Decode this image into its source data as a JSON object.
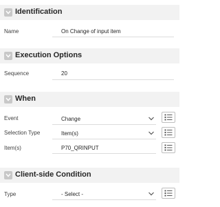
{
  "sections": {
    "identification": {
      "title": "Identification",
      "name_label": "Name",
      "name_value": "On Change of input  item"
    },
    "execution_options": {
      "title": "Execution Options",
      "sequence_label": "Sequence",
      "sequence_value": "20"
    },
    "when": {
      "title": "When",
      "event_label": "Event",
      "event_value": "Change",
      "selection_type_label": "Selection Type",
      "selection_type_value": "Item(s)",
      "items_label": "Item(s)",
      "items_value": "P70_QRINPUT"
    },
    "client_side_condition": {
      "title": "Client-side Condition",
      "type_label": "Type",
      "type_value": "- Select -"
    }
  },
  "icons": {
    "collapse": "chevron-down-icon",
    "dropdown": "chevron-down-icon",
    "list": "list-icon"
  },
  "colors": {
    "header_bg": "#f2f2f2",
    "icon_bg": "#c8c8c8",
    "divider": "#dcdcdc"
  }
}
